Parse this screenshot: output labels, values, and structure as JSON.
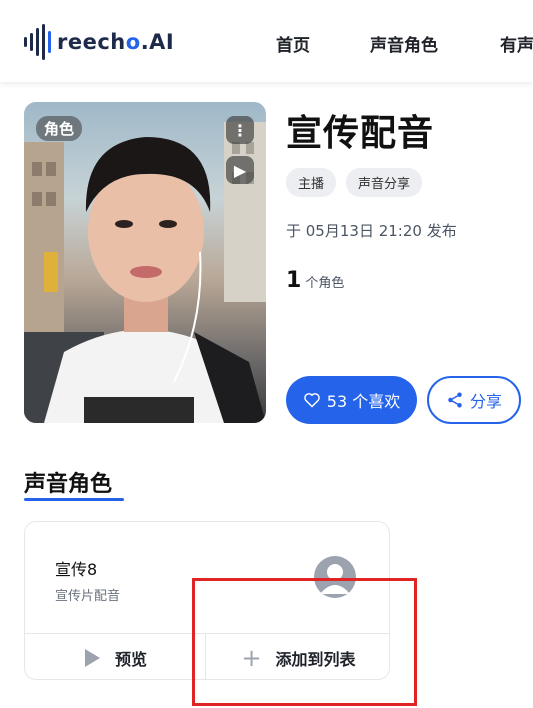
{
  "header": {
    "logo_text_a": "reech",
    "logo_text_b": "o",
    "logo_text_c": ".AI",
    "nav": [
      "首页",
      "声音角色",
      "有声"
    ]
  },
  "cover": {
    "badge": "角色",
    "menu_icon": "more-vertical-icon",
    "play_icon": "play-icon"
  },
  "info": {
    "title": "宣传配音",
    "tags": [
      "主播",
      "声音分享"
    ],
    "publish": "于 05月13日 21:20 发布",
    "count_number": "1",
    "count_label": "个角色",
    "like_label": "53 个喜欢",
    "share_label": "分享"
  },
  "section": {
    "title": "声音角色"
  },
  "card": {
    "name": "宣传8",
    "desc": "宣传片配音",
    "preview_label": "预览",
    "add_label": "添加到列表"
  },
  "colors": {
    "accent": "#2563eb",
    "highlight_box": "#e02424"
  }
}
